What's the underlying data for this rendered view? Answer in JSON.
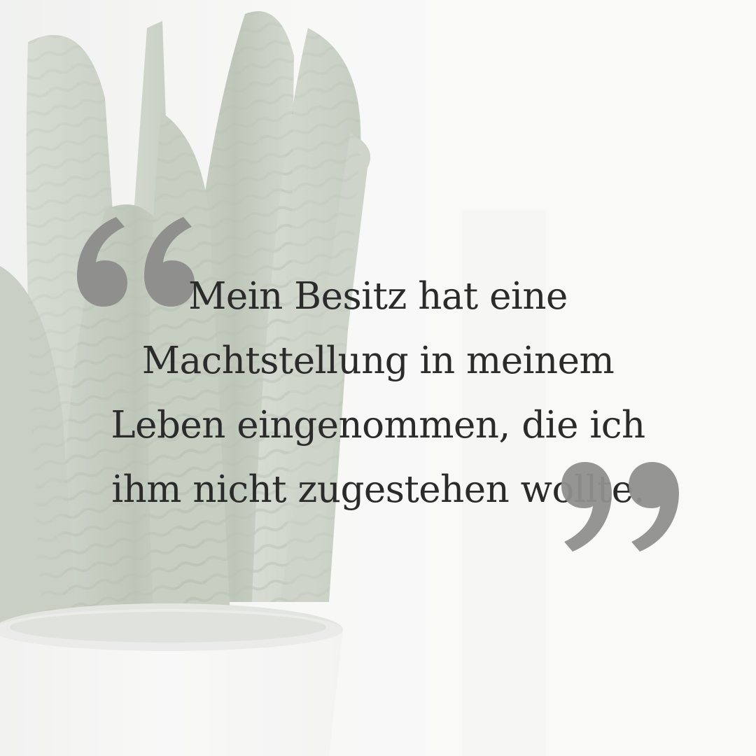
{
  "quote": {
    "lines": [
      "Mein Besitz hat eine",
      "Machtstellung in meinem",
      "Leben eingenommen, die ich",
      "ihm nicht zugestehen wollte."
    ]
  },
  "decor": {
    "open_quote_icon": "opening-quotation-mark",
    "close_quote_icon": "closing-quotation-mark",
    "quote_mark_color": "#8f8f8d",
    "text_color": "#2b2b2b",
    "background_subject": "snake-plant-in-white-pot"
  }
}
